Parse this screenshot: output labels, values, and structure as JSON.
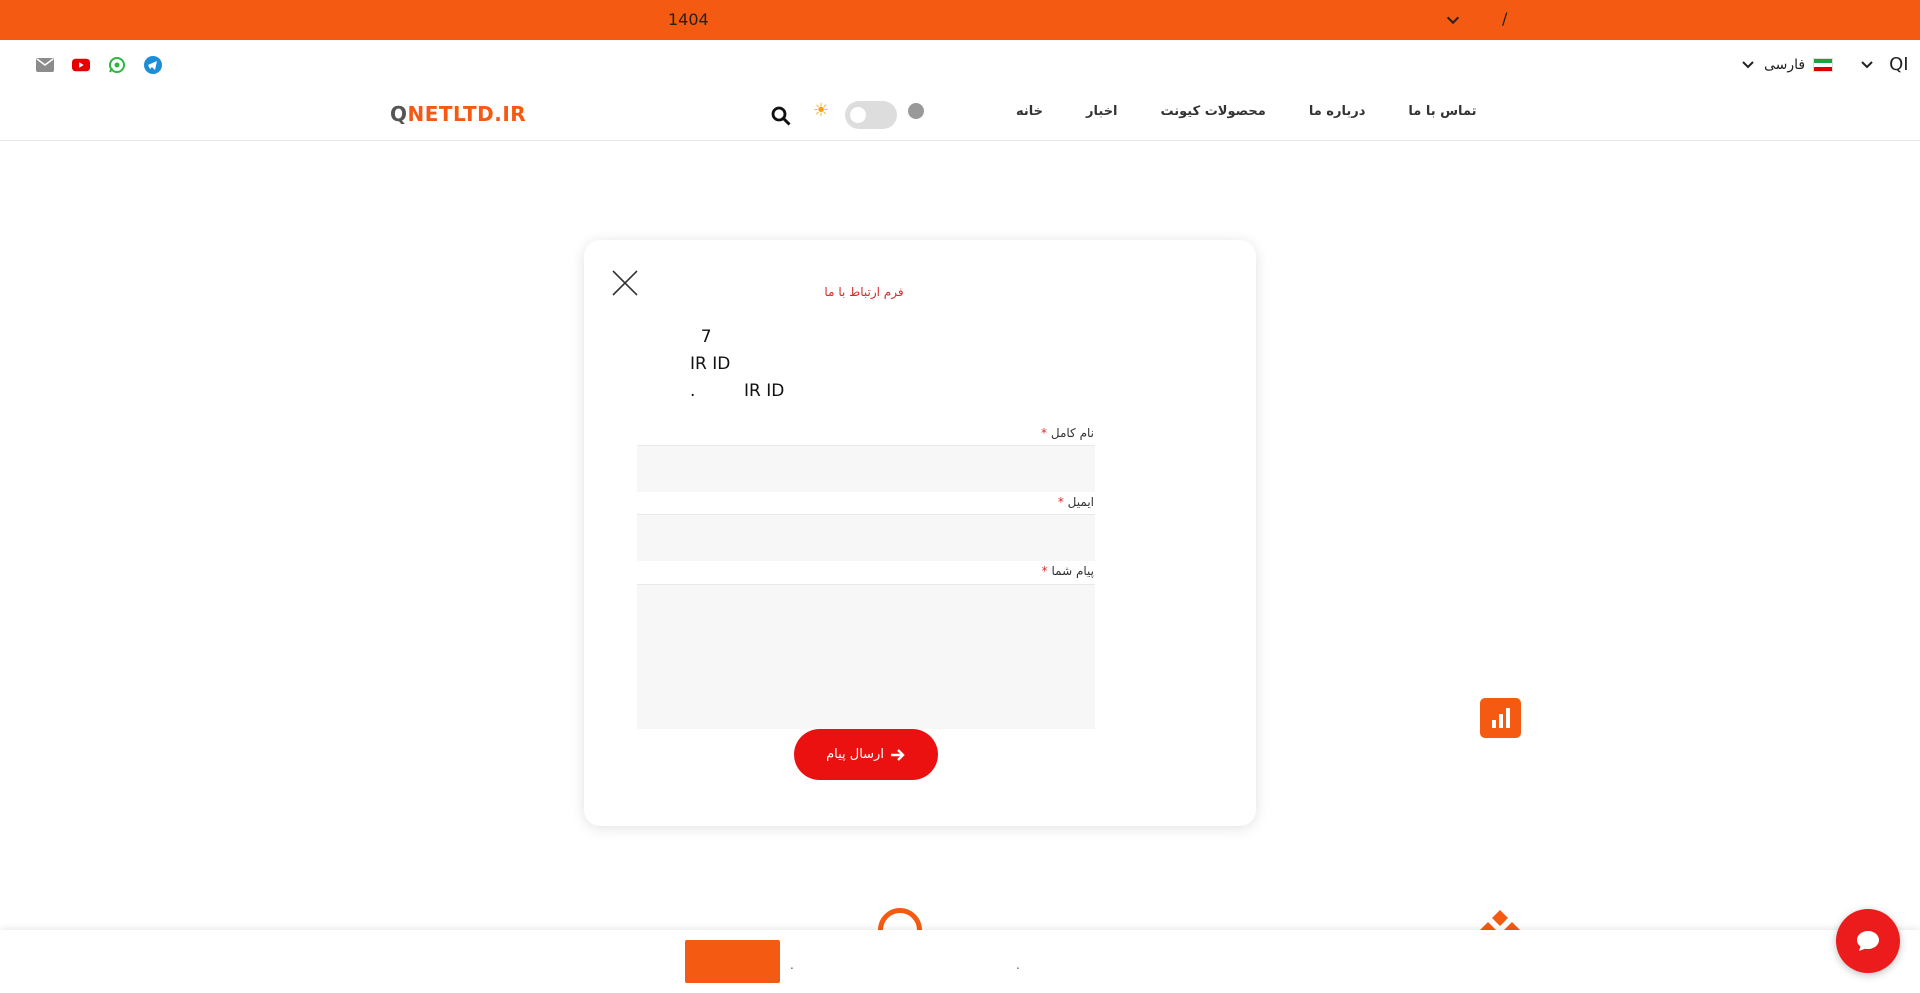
{
  "topbar": {
    "year": "1404",
    "separator": "/"
  },
  "header": {
    "social_icons": [
      "email-icon",
      "youtube-icon",
      "whatsapp-icon",
      "telegram-icon"
    ],
    "language_label": "فارسی",
    "account_label": "QI",
    "logo_q": "Q",
    "logo_rest": "NETLTD.IR"
  },
  "nav": {
    "items": [
      "خانه",
      "اخبار",
      "محصولات کیونت",
      "درباره ما",
      "تماس با ما"
    ]
  },
  "modal": {
    "title": "فرم ارتباط با ما",
    "info_lines": [
      "  7",
      "IR ID",
      ".         IR ID"
    ],
    "fields": {
      "name_label": "نام کامل",
      "email_label": "ایمیل",
      "message_label": "پیام شما"
    },
    "required_mark": "*",
    "submit_label": "ارسال پیام"
  },
  "colors": {
    "brand": "#f45a12",
    "accent_red": "#ec1111"
  }
}
